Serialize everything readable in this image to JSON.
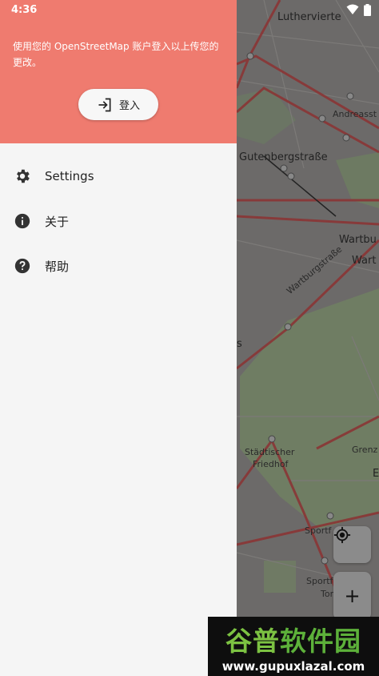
{
  "status_bar": {
    "time": "4:36"
  },
  "drawer": {
    "header_text": "使用您的 OpenStreetMap 账户登入以上传您的更改。",
    "login_label": "登入",
    "menu": [
      {
        "label": "Settings",
        "icon": "gear-icon"
      },
      {
        "label": "关于",
        "icon": "info-icon"
      },
      {
        "label": "帮助",
        "icon": "help-icon"
      }
    ]
  },
  "map": {
    "labels": {
      "luthervierte": "Luthervierte",
      "andreas": "Andreasst",
      "gutenberg": "Gutenbergstraße",
      "wartbu1": "Wartbu",
      "wartbu2": "Wart",
      "wartburgstrasse": "Wartburgstraße",
      "s": "s",
      "stadtischer": "Städtischer",
      "friedhof": "Friedhof",
      "grenz": "Grenz",
      "e": "E",
      "sportf1": "Sportf",
      "sportf2": "Sportf",
      "tor": "Tor"
    },
    "zoom_in_label": "+",
    "colors": {
      "route": "#7a2a2a",
      "park": "#6e7e62"
    }
  },
  "watermark": {
    "brand_part1": "谷普",
    "brand_part2": "软件园",
    "url": "www.gupuxlazal.com"
  }
}
